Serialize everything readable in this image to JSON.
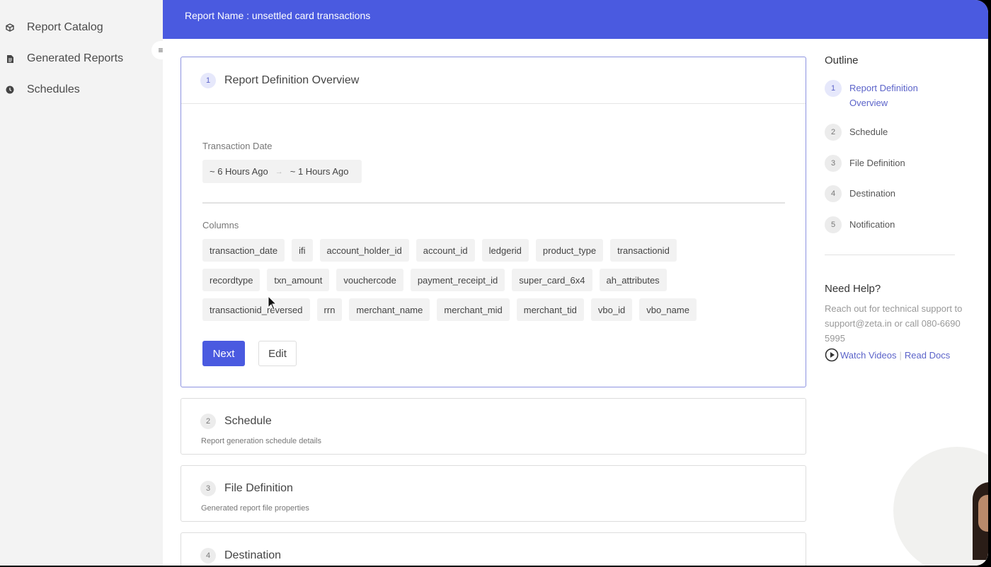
{
  "sidebar": {
    "items": [
      {
        "label": "Report Catalog",
        "icon": "cube-icon"
      },
      {
        "label": "Generated Reports",
        "icon": "document-icon"
      },
      {
        "label": "Schedules",
        "icon": "clock-icon"
      }
    ],
    "collapse_icon": "≡"
  },
  "header": {
    "title": "Report Name : unsettled card transactions"
  },
  "step1": {
    "number": "1",
    "title": "Report Definition Overview",
    "transaction_date_label": "Transaction Date",
    "date_from": "~ 6 Hours Ago",
    "date_arrow": "→",
    "date_to": "~ 1 Hours Ago",
    "columns_label": "Columns",
    "columns_row1": [
      "transaction_date",
      "ifi",
      "account_holder_id",
      "account_id",
      "ledgerid",
      "product_type",
      "transactionid"
    ],
    "columns_row2": [
      "recordtype",
      "txn_amount",
      "vouchercode",
      "payment_receipt_id",
      "super_card_6x4",
      "ah_attributes"
    ],
    "columns_row3": [
      "transactionid_reversed",
      "rrn",
      "merchant_name",
      "merchant_mid",
      "merchant_tid",
      "vbo_id",
      "vbo_name"
    ],
    "next_label": "Next",
    "edit_label": "Edit"
  },
  "step2": {
    "number": "2",
    "title": "Schedule",
    "subtitle": "Report generation schedule details"
  },
  "step3": {
    "number": "3",
    "title": "File Definition",
    "subtitle": "Generated report file properties"
  },
  "step4": {
    "number": "4",
    "title": "Destination"
  },
  "outline": {
    "title": "Outline",
    "items": [
      {
        "number": "1",
        "label": "Report Definition Overview"
      },
      {
        "number": "2",
        "label": "Schedule"
      },
      {
        "number": "3",
        "label": "File Definition"
      },
      {
        "number": "4",
        "label": "Destination"
      },
      {
        "number": "5",
        "label": "Notification"
      }
    ]
  },
  "help": {
    "title": "Need Help?",
    "text": "Reach out for technical support to support@zeta.in or call 080-6690 5995",
    "watch_videos": "Watch Videos",
    "separator": "|",
    "read_docs": "Read Docs"
  },
  "colors": {
    "accent": "#4a5ae0",
    "sidebar_bg": "#f3f3f3",
    "chip_bg": "#f2f2f2",
    "active_border": "#8d93e0"
  }
}
